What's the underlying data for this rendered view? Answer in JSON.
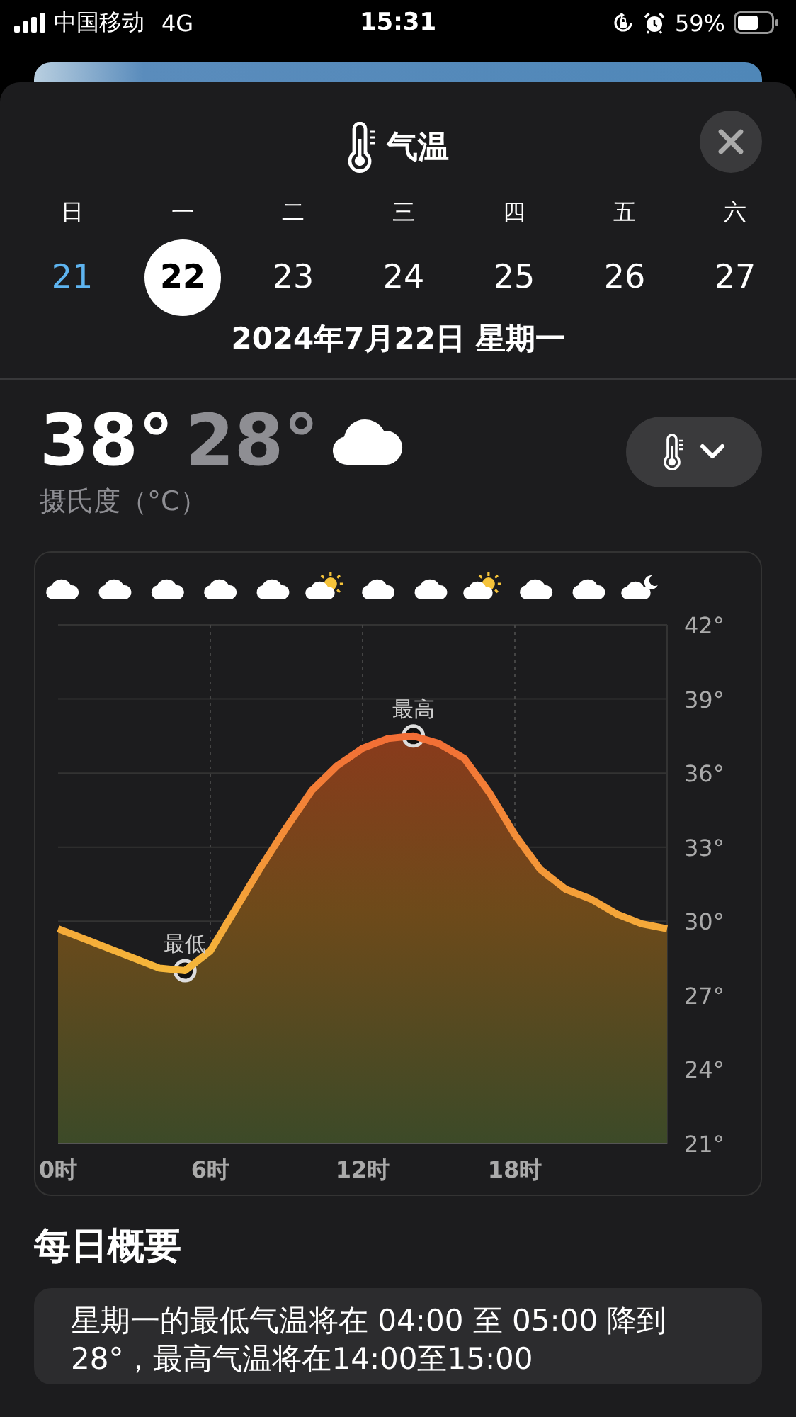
{
  "status_bar": {
    "carrier": "中国移动",
    "network": "4G",
    "time": "15:31",
    "battery": "59%"
  },
  "sheet": {
    "title": "气温",
    "weekdays": [
      "日",
      "一",
      "二",
      "三",
      "四",
      "五",
      "六"
    ],
    "dates": [
      {
        "label": "21",
        "selected": false,
        "today": true
      },
      {
        "label": "22",
        "selected": true,
        "today": false
      },
      {
        "label": "23",
        "selected": false,
        "today": false
      },
      {
        "label": "24",
        "selected": false,
        "today": false
      },
      {
        "label": "25",
        "selected": false,
        "today": false
      },
      {
        "label": "26",
        "selected": false,
        "today": false
      },
      {
        "label": "27",
        "selected": false,
        "today": false
      }
    ],
    "full_date": "2024年7月22日 星期一",
    "high": "38°",
    "low": "28°",
    "unit": "摄氏度（°C）",
    "hourly_icons": [
      {
        "kind": "cloud"
      },
      {
        "kind": "cloud"
      },
      {
        "kind": "cloud"
      },
      {
        "kind": "cloud"
      },
      {
        "kind": "cloud"
      },
      {
        "kind": "sun-cloud"
      },
      {
        "kind": "cloud"
      },
      {
        "kind": "cloud"
      },
      {
        "kind": "sun-cloud"
      },
      {
        "kind": "cloud"
      },
      {
        "kind": "cloud"
      },
      {
        "kind": "moon-cloud"
      }
    ],
    "chart_data": {
      "type": "area",
      "x": [
        0,
        1,
        2,
        3,
        4,
        5,
        6,
        7,
        8,
        9,
        10,
        11,
        12,
        13,
        14,
        15,
        16,
        17,
        18,
        19,
        20,
        21,
        22,
        23,
        24
      ],
      "values": [
        29.7,
        29.3,
        28.9,
        28.5,
        28.1,
        28.0,
        28.8,
        30.5,
        32.2,
        33.8,
        35.3,
        36.3,
        37.0,
        37.4,
        37.5,
        37.2,
        36.6,
        35.2,
        33.5,
        32.1,
        31.3,
        30.9,
        30.3,
        29.9,
        29.7
      ],
      "xlim": [
        0,
        24
      ],
      "ylim": [
        21,
        42
      ],
      "grid": true,
      "xticks": [
        {
          "value": 0,
          "label": "0时"
        },
        {
          "value": 6,
          "label": "6时"
        },
        {
          "value": 12,
          "label": "12时"
        },
        {
          "value": 18,
          "label": "18时"
        }
      ],
      "yticks": [
        {
          "value": 42,
          "label": "42°"
        },
        {
          "value": 39,
          "label": "39°"
        },
        {
          "value": 36,
          "label": "36°"
        },
        {
          "value": 33,
          "label": "33°"
        },
        {
          "value": 30,
          "label": "30°"
        },
        {
          "value": 27,
          "label": "27°"
        },
        {
          "value": 24,
          "label": "24°"
        },
        {
          "value": 21,
          "label": "21°"
        }
      ],
      "annotations": [
        {
          "x": 5,
          "y": 28.0,
          "text": "最低"
        },
        {
          "x": 14,
          "y": 37.5,
          "text": "最高"
        }
      ]
    },
    "summary_title": "每日概要",
    "summary": "星期一的最低气温将在 04:00 至 05:00 降到28°，最高气温将在14:00至15:00"
  }
}
